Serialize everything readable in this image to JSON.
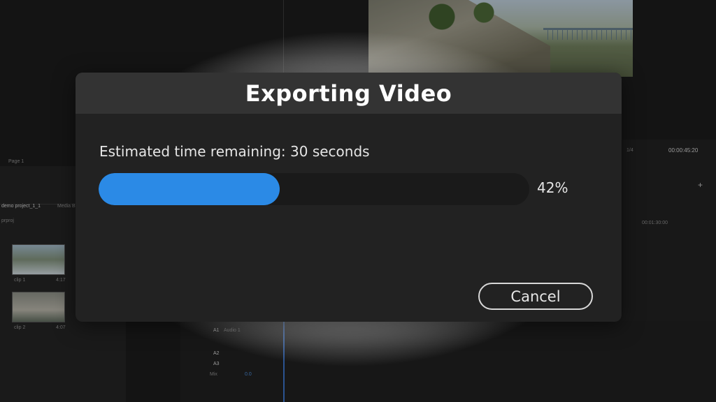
{
  "dialog": {
    "title": "Exporting Video",
    "status_text": "Estimated time remaining: 30 seconds",
    "progress_fraction": 0.42,
    "progress_label": "42%",
    "cancel_label": "Cancel"
  },
  "background_app": {
    "page_selector": "Page 1",
    "project_tab": "demo project_1_1",
    "media_tab": "Media B",
    "project_file": "prproj",
    "clips": [
      {
        "name": "clip 1",
        "duration": "4:17"
      },
      {
        "name": "clip 2",
        "duration": "4:07"
      }
    ],
    "zoom_label": "1/4",
    "timecode": "00:00:45:20",
    "ruler_time": "00:01:30:00",
    "audio_track_name": "Audio 1",
    "audio_tracks": [
      "A1",
      "A2",
      "A3"
    ],
    "mix_label": "Mix",
    "mix_value": "0.0"
  },
  "colors": {
    "progress_fill": "#2b8ae6",
    "dialog_bg": "#222222",
    "header_bg": "#333333"
  }
}
